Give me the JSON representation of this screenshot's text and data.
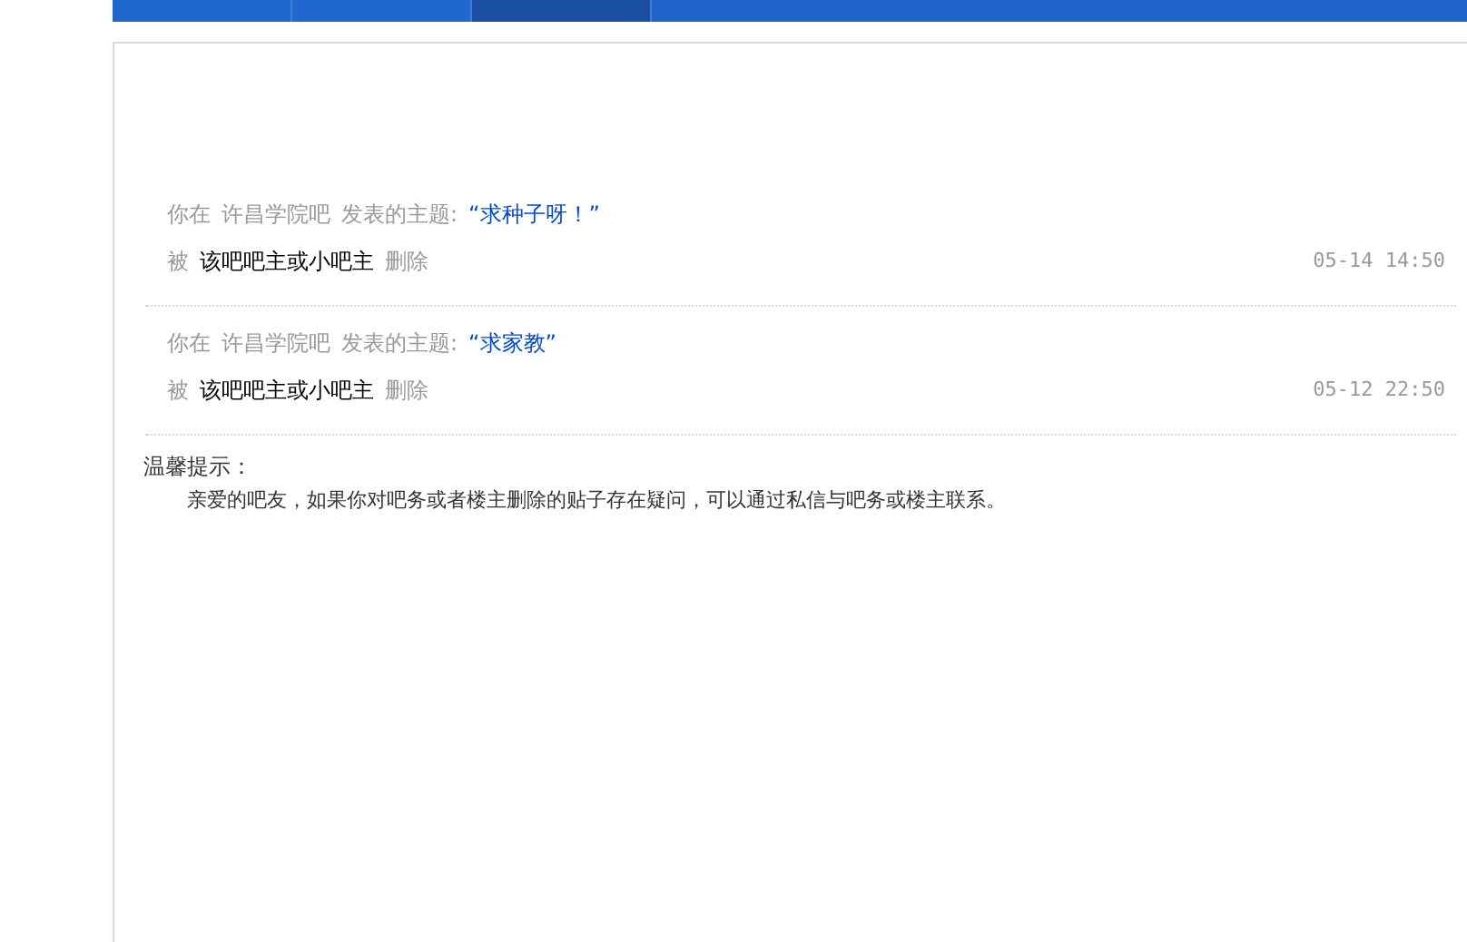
{
  "tabs": [
    {
      "selected": false
    },
    {
      "selected": false
    },
    {
      "selected": true
    }
  ],
  "posts": [
    {
      "prefix": "你在",
      "forum": "许昌学院吧",
      "action": "发表的主题:",
      "title": "“求种子呀！”",
      "by": "被",
      "deleter": "该吧吧主或小吧主",
      "deleted": "删除",
      "time": "05-14 14:50"
    },
    {
      "prefix": "你在",
      "forum": "许昌学院吧",
      "action": "发表的主题:",
      "title": "“求家教”",
      "by": "被",
      "deleter": "该吧吧主或小吧主",
      "deleted": "删除",
      "time": "05-12 22:50"
    }
  ],
  "tip": {
    "heading": "温馨提示：",
    "text": "亲爱的吧友，如果你对吧务或者楼主删除的贴子存在疑问，可以通过私信与吧务或楼主联系。"
  }
}
